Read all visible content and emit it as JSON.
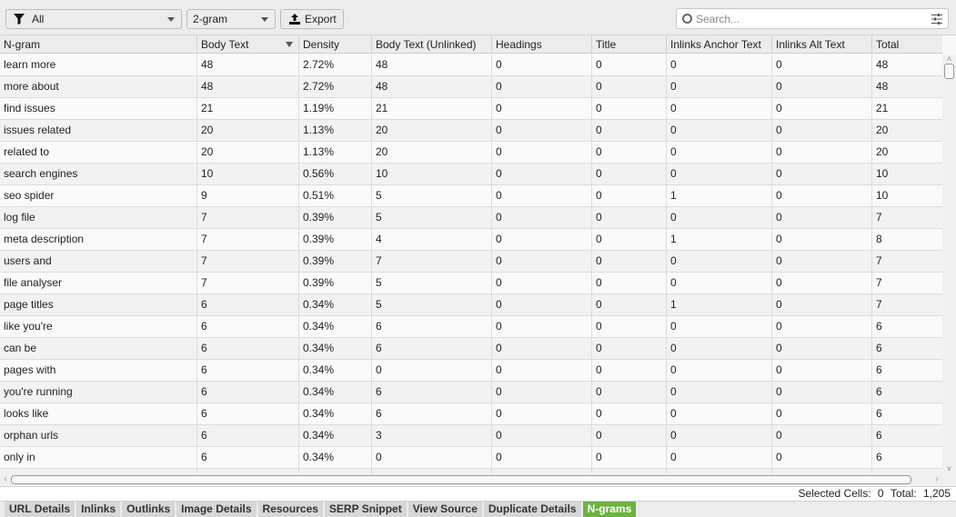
{
  "toolbar": {
    "filter": {
      "icon": "funnel-icon",
      "value": "All"
    },
    "ngram_size": {
      "value": "2-gram"
    },
    "export_label": "Export",
    "search_placeholder": "Search...",
    "search_value": ""
  },
  "table": {
    "columns": [
      "N-gram",
      "Body Text",
      "Density",
      "Body Text (Unlinked)",
      "Headings",
      "Title",
      "Inlinks Anchor Text",
      "Inlinks Alt Text",
      "Total"
    ],
    "sorted_column": "Body Text",
    "sort_direction": "descending",
    "rows": [
      [
        "learn more",
        "48",
        "2.72%",
        "48",
        "0",
        "0",
        "0",
        "0",
        "48"
      ],
      [
        "more about",
        "48",
        "2.72%",
        "48",
        "0",
        "0",
        "0",
        "0",
        "48"
      ],
      [
        "find issues",
        "21",
        "1.19%",
        "21",
        "0",
        "0",
        "0",
        "0",
        "21"
      ],
      [
        "issues related",
        "20",
        "1.13%",
        "20",
        "0",
        "0",
        "0",
        "0",
        "20"
      ],
      [
        "related to",
        "20",
        "1.13%",
        "20",
        "0",
        "0",
        "0",
        "0",
        "20"
      ],
      [
        "search engines",
        "10",
        "0.56%",
        "10",
        "0",
        "0",
        "0",
        "0",
        "10"
      ],
      [
        "seo spider",
        "9",
        "0.51%",
        "5",
        "0",
        "0",
        "1",
        "0",
        "10"
      ],
      [
        "log file",
        "7",
        "0.39%",
        "5",
        "0",
        "0",
        "0",
        "0",
        "7"
      ],
      [
        "meta description",
        "7",
        "0.39%",
        "4",
        "0",
        "0",
        "1",
        "0",
        "8"
      ],
      [
        "users and",
        "7",
        "0.39%",
        "7",
        "0",
        "0",
        "0",
        "0",
        "7"
      ],
      [
        "file analyser",
        "7",
        "0.39%",
        "5",
        "0",
        "0",
        "0",
        "0",
        "7"
      ],
      [
        "page titles",
        "6",
        "0.34%",
        "5",
        "0",
        "0",
        "1",
        "0",
        "7"
      ],
      [
        "like you're",
        "6",
        "0.34%",
        "6",
        "0",
        "0",
        "0",
        "0",
        "6"
      ],
      [
        "can be",
        "6",
        "0.34%",
        "6",
        "0",
        "0",
        "0",
        "0",
        "6"
      ],
      [
        "pages with",
        "6",
        "0.34%",
        "0",
        "0",
        "0",
        "0",
        "0",
        "6"
      ],
      [
        "you're running",
        "6",
        "0.34%",
        "6",
        "0",
        "0",
        "0",
        "0",
        "6"
      ],
      [
        "looks like",
        "6",
        "0.34%",
        "6",
        "0",
        "0",
        "0",
        "0",
        "6"
      ],
      [
        "orphan urls",
        "6",
        "0.34%",
        "3",
        "0",
        "0",
        "0",
        "0",
        "6"
      ],
      [
        "only in",
        "6",
        "0.34%",
        "0",
        "0",
        "0",
        "0",
        "0",
        "6"
      ],
      [
        "",
        "",
        "",
        "",
        "",
        "",
        "",
        "",
        ""
      ]
    ]
  },
  "status": {
    "selected_label": "Selected Cells:",
    "selected_value": "0",
    "total_label": "Total:",
    "total_value": "1,205"
  },
  "tabs": [
    {
      "label": "URL Details",
      "active": false
    },
    {
      "label": "Inlinks",
      "active": false
    },
    {
      "label": "Outlinks",
      "active": false
    },
    {
      "label": "Image Details",
      "active": false
    },
    {
      "label": "Resources",
      "active": false
    },
    {
      "label": "SERP Snippet",
      "active": false
    },
    {
      "label": "View Source",
      "active": false
    },
    {
      "label": "Duplicate Details",
      "active": false
    },
    {
      "label": "N-grams",
      "active": true
    }
  ],
  "colors": {
    "active_tab": "#6db33f",
    "tab_bg": "#d7d7d7"
  }
}
